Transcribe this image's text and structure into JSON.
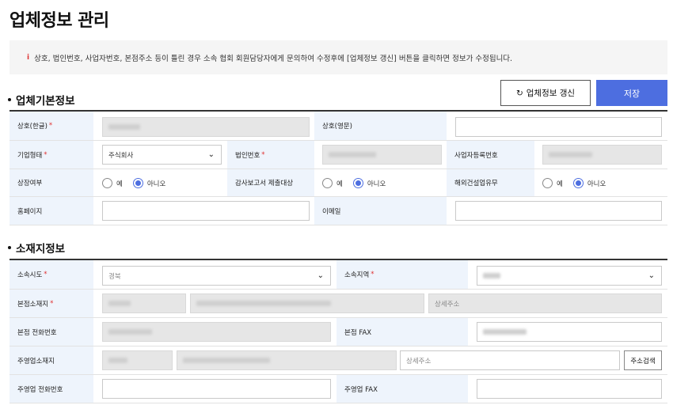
{
  "page": {
    "title": "업체정보 관리",
    "notice": "상호, 법인번호, 사업자번호, 본점주소 등이 틀린 경우 소속 협회 회원담당자에게 문의하여 수정후에 [업체정보 갱신] 버튼을 클릭하면 정보가 수정됩니다.",
    "notice_icon": "i"
  },
  "actions": {
    "refresh_icon": "↻",
    "refresh_label": "업체정보 갱신",
    "save_label": "저장"
  },
  "basic": {
    "title": "업체기본정보",
    "name_ko_label": "상호(한글)",
    "name_en_label": "상호(영문)",
    "name_en_value": "",
    "company_type_label": "기업형태",
    "company_type_value": "주식회사",
    "corp_no_label": "법인번호",
    "biz_no_label": "사업자등록번호",
    "listed_label": "상장여부",
    "audit_label": "감사보고서 제출대상",
    "overseas_label": "해외건설업유무",
    "yes": "예",
    "no": "아니오",
    "homepage_label": "홈페이지",
    "homepage_value": "",
    "email_label": "이메일",
    "email_value": "",
    "required_mark": "*"
  },
  "location": {
    "title": "소재지정보",
    "province_label": "소속시도",
    "province_value": "경북",
    "region_label": "소속지역",
    "hq_address_label": "본점소재지",
    "hq_detail_placeholder": "상세주소",
    "hq_phone_label": "본점 전화번호",
    "hq_fax_label": "본점 FAX",
    "main_address_label": "주영업소재지",
    "main_detail_placeholder": "상세주소",
    "address_search_label": "주소검색",
    "main_phone_label": "주영업 전화번호",
    "main_phone_value": "",
    "main_fax_label": "주영업 FAX",
    "main_fax_value": "",
    "required_mark": "*"
  },
  "colors": {
    "accent": "#4d6ee0",
    "required": "#e03030",
    "label_bg": "#eef4fc",
    "notice_bg": "#f5f5f5",
    "readonly_bg": "#e6e6e6"
  }
}
